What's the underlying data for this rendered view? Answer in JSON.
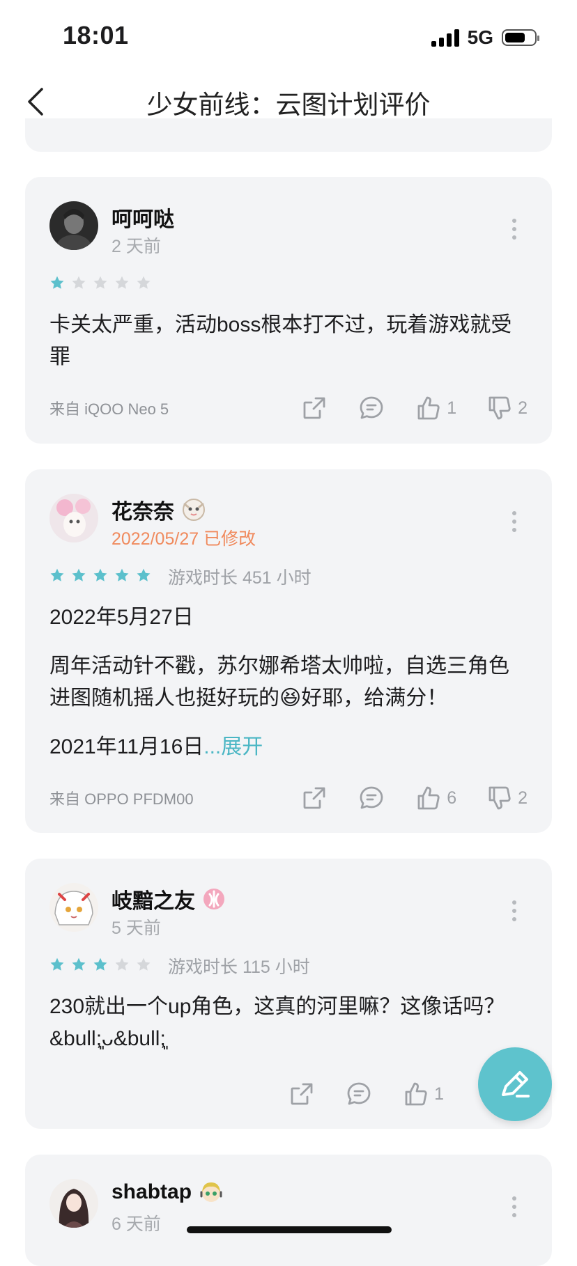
{
  "status_bar": {
    "time": "18:01",
    "network": "5G"
  },
  "nav": {
    "title": "少女前线：云图计划评价"
  },
  "reviews": [
    {
      "name": "呵呵哒",
      "meta": "2 天前",
      "rating": 1,
      "playtime": "",
      "paragraphs": [
        "卡关太严重，活动boss根本打不过，玩着游戏就受罪"
      ],
      "device": "来自 iQOO Neo 5",
      "likes": "1",
      "dislikes": "2"
    },
    {
      "name": "花奈奈",
      "meta": "2022/05/27 已修改",
      "rating": 5,
      "playtime": "游戏时长 451 小时",
      "paragraphs": [
        "2022年5月27日",
        "周年活动针不戳，苏尔娜希塔太帅啦，自选三角色进图随机摇人也挺好玩的😆好耶，给满分！",
        "2021年11月16日"
      ],
      "expand": "...展开",
      "device": "来自 OPPO PFDM00",
      "likes": "6",
      "dislikes": "2"
    },
    {
      "name": "岐黯之友",
      "meta": "5 天前",
      "rating": 3,
      "playtime": "游戏时长 115 小时",
      "paragraphs": [
        "230就出一个up角色，这真的河里嘛？这像话吗？ &bull;͈ᴗ&bull;͈"
      ],
      "device": "",
      "likes": "1",
      "dislikes": ""
    },
    {
      "name": "shabtap",
      "meta": "6 天前",
      "rating": 0,
      "playtime": "",
      "paragraphs": [],
      "device": "",
      "likes": "",
      "dislikes": ""
    }
  ],
  "colors": {
    "accent": "#4ab6c4",
    "star_on": "#5cc0cc",
    "star_off": "#d5d7da",
    "modified": "#f08a5d",
    "card_bg": "#f3f4f6"
  },
  "icons": [
    "back-arrow-icon",
    "share-icon",
    "comment-icon",
    "thumbs-up-icon",
    "thumbs-down-icon",
    "more-icon",
    "pen-icon"
  ]
}
